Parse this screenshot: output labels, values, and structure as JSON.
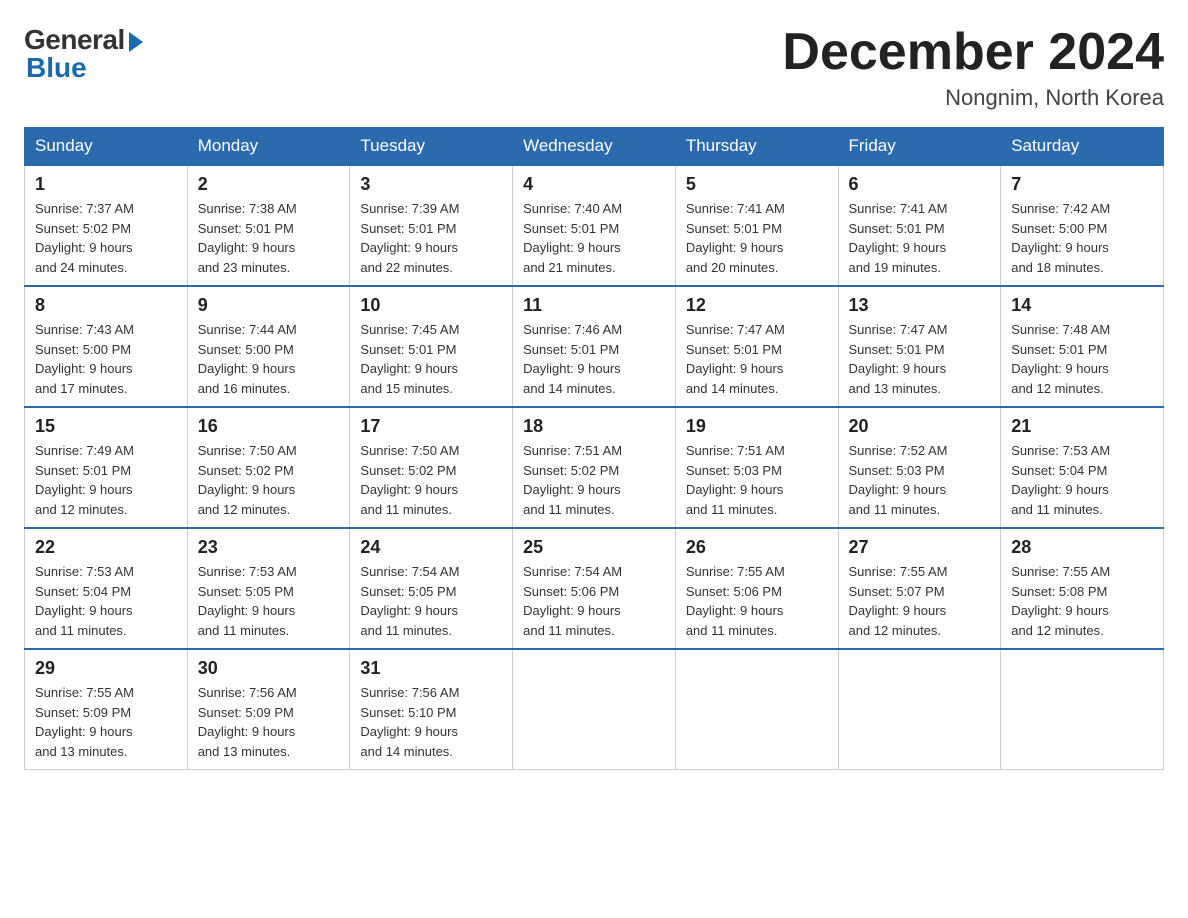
{
  "logo": {
    "general": "General",
    "blue": "Blue"
  },
  "title": "December 2024",
  "subtitle": "Nongnim, North Korea",
  "days_of_week": [
    "Sunday",
    "Monday",
    "Tuesday",
    "Wednesday",
    "Thursday",
    "Friday",
    "Saturday"
  ],
  "weeks": [
    [
      {
        "day": "1",
        "sunrise": "7:37 AM",
        "sunset": "5:02 PM",
        "daylight": "9 hours and 24 minutes."
      },
      {
        "day": "2",
        "sunrise": "7:38 AM",
        "sunset": "5:01 PM",
        "daylight": "9 hours and 23 minutes."
      },
      {
        "day": "3",
        "sunrise": "7:39 AM",
        "sunset": "5:01 PM",
        "daylight": "9 hours and 22 minutes."
      },
      {
        "day": "4",
        "sunrise": "7:40 AM",
        "sunset": "5:01 PM",
        "daylight": "9 hours and 21 minutes."
      },
      {
        "day": "5",
        "sunrise": "7:41 AM",
        "sunset": "5:01 PM",
        "daylight": "9 hours and 20 minutes."
      },
      {
        "day": "6",
        "sunrise": "7:41 AM",
        "sunset": "5:01 PM",
        "daylight": "9 hours and 19 minutes."
      },
      {
        "day": "7",
        "sunrise": "7:42 AM",
        "sunset": "5:00 PM",
        "daylight": "9 hours and 18 minutes."
      }
    ],
    [
      {
        "day": "8",
        "sunrise": "7:43 AM",
        "sunset": "5:00 PM",
        "daylight": "9 hours and 17 minutes."
      },
      {
        "day": "9",
        "sunrise": "7:44 AM",
        "sunset": "5:00 PM",
        "daylight": "9 hours and 16 minutes."
      },
      {
        "day": "10",
        "sunrise": "7:45 AM",
        "sunset": "5:01 PM",
        "daylight": "9 hours and 15 minutes."
      },
      {
        "day": "11",
        "sunrise": "7:46 AM",
        "sunset": "5:01 PM",
        "daylight": "9 hours and 14 minutes."
      },
      {
        "day": "12",
        "sunrise": "7:47 AM",
        "sunset": "5:01 PM",
        "daylight": "9 hours and 14 minutes."
      },
      {
        "day": "13",
        "sunrise": "7:47 AM",
        "sunset": "5:01 PM",
        "daylight": "9 hours and 13 minutes."
      },
      {
        "day": "14",
        "sunrise": "7:48 AM",
        "sunset": "5:01 PM",
        "daylight": "9 hours and 12 minutes."
      }
    ],
    [
      {
        "day": "15",
        "sunrise": "7:49 AM",
        "sunset": "5:01 PM",
        "daylight": "9 hours and 12 minutes."
      },
      {
        "day": "16",
        "sunrise": "7:50 AM",
        "sunset": "5:02 PM",
        "daylight": "9 hours and 12 minutes."
      },
      {
        "day": "17",
        "sunrise": "7:50 AM",
        "sunset": "5:02 PM",
        "daylight": "9 hours and 11 minutes."
      },
      {
        "day": "18",
        "sunrise": "7:51 AM",
        "sunset": "5:02 PM",
        "daylight": "9 hours and 11 minutes."
      },
      {
        "day": "19",
        "sunrise": "7:51 AM",
        "sunset": "5:03 PM",
        "daylight": "9 hours and 11 minutes."
      },
      {
        "day": "20",
        "sunrise": "7:52 AM",
        "sunset": "5:03 PM",
        "daylight": "9 hours and 11 minutes."
      },
      {
        "day": "21",
        "sunrise": "7:53 AM",
        "sunset": "5:04 PM",
        "daylight": "9 hours and 11 minutes."
      }
    ],
    [
      {
        "day": "22",
        "sunrise": "7:53 AM",
        "sunset": "5:04 PM",
        "daylight": "9 hours and 11 minutes."
      },
      {
        "day": "23",
        "sunrise": "7:53 AM",
        "sunset": "5:05 PM",
        "daylight": "9 hours and 11 minutes."
      },
      {
        "day": "24",
        "sunrise": "7:54 AM",
        "sunset": "5:05 PM",
        "daylight": "9 hours and 11 minutes."
      },
      {
        "day": "25",
        "sunrise": "7:54 AM",
        "sunset": "5:06 PM",
        "daylight": "9 hours and 11 minutes."
      },
      {
        "day": "26",
        "sunrise": "7:55 AM",
        "sunset": "5:06 PM",
        "daylight": "9 hours and 11 minutes."
      },
      {
        "day": "27",
        "sunrise": "7:55 AM",
        "sunset": "5:07 PM",
        "daylight": "9 hours and 12 minutes."
      },
      {
        "day": "28",
        "sunrise": "7:55 AM",
        "sunset": "5:08 PM",
        "daylight": "9 hours and 12 minutes."
      }
    ],
    [
      {
        "day": "29",
        "sunrise": "7:55 AM",
        "sunset": "5:09 PM",
        "daylight": "9 hours and 13 minutes."
      },
      {
        "day": "30",
        "sunrise": "7:56 AM",
        "sunset": "5:09 PM",
        "daylight": "9 hours and 13 minutes."
      },
      {
        "day": "31",
        "sunrise": "7:56 AM",
        "sunset": "5:10 PM",
        "daylight": "9 hours and 14 minutes."
      },
      null,
      null,
      null,
      null
    ]
  ],
  "labels": {
    "sunrise": "Sunrise:",
    "sunset": "Sunset:",
    "daylight": "Daylight:"
  }
}
